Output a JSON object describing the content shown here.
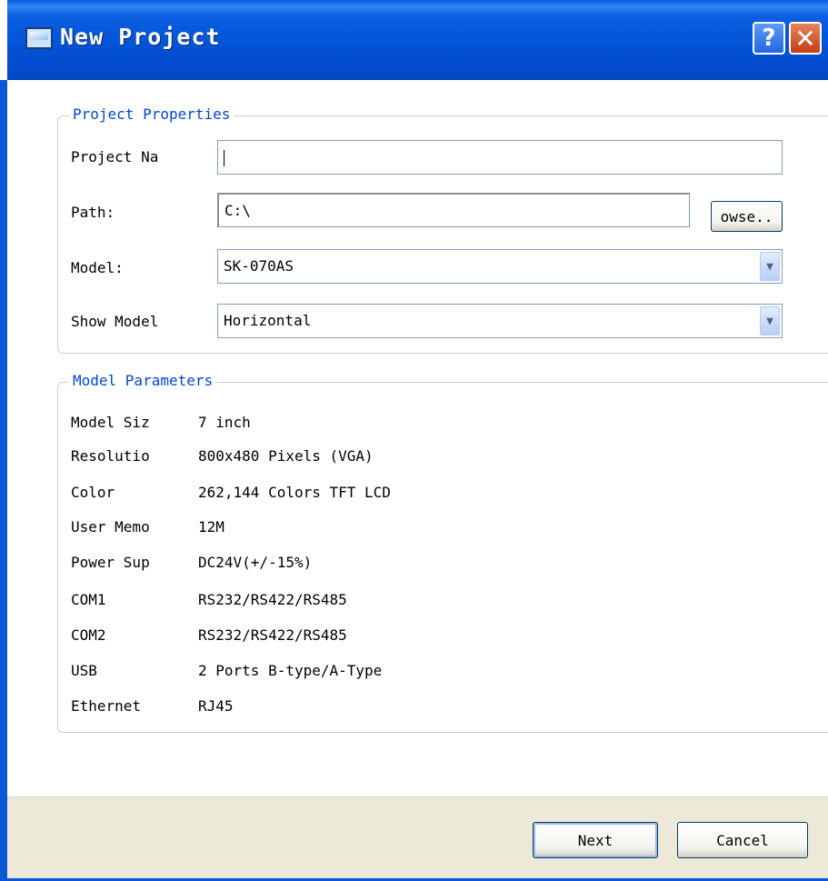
{
  "window": {
    "title": "New Project",
    "help_label": "?",
    "close_label": "✕"
  },
  "project_properties": {
    "legend": "Project Properties",
    "name_label": "Project Na",
    "name_value": "",
    "path_label": "Path:",
    "path_value": "C:\\",
    "browse_label": "owse..",
    "model_label": "Model:",
    "model_value": "SK-070AS",
    "show_model_label": "Show Model",
    "show_model_value": "Horizontal"
  },
  "model_parameters": {
    "legend": "Model Parameters",
    "rows": [
      {
        "name": "Model Siz",
        "value": "7 inch"
      },
      {
        "name": "Resolutio",
        "value": "800x480 Pixels (VGA)"
      },
      {
        "name": "Color",
        "value": "262,144 Colors TFT LCD"
      },
      {
        "name": "User Memo",
        "value": "12M"
      },
      {
        "name": "Power Sup",
        "value": "DC24V(+/-15%)"
      },
      {
        "name": "COM1",
        "value": "RS232/RS422/RS485"
      },
      {
        "name": "COM2",
        "value": "RS232/RS422/RS485"
      },
      {
        "name": "USB",
        "value": "2 Ports B-type/A-Type"
      },
      {
        "name": "Ethernet",
        "value": "RJ45"
      }
    ]
  },
  "footer": {
    "next_label": "Next",
    "cancel_label": "Cancel"
  },
  "colors": {
    "titlebar": "#0252d6",
    "legend_text": "#0046d5",
    "footer_bg": "#ece9d8"
  }
}
